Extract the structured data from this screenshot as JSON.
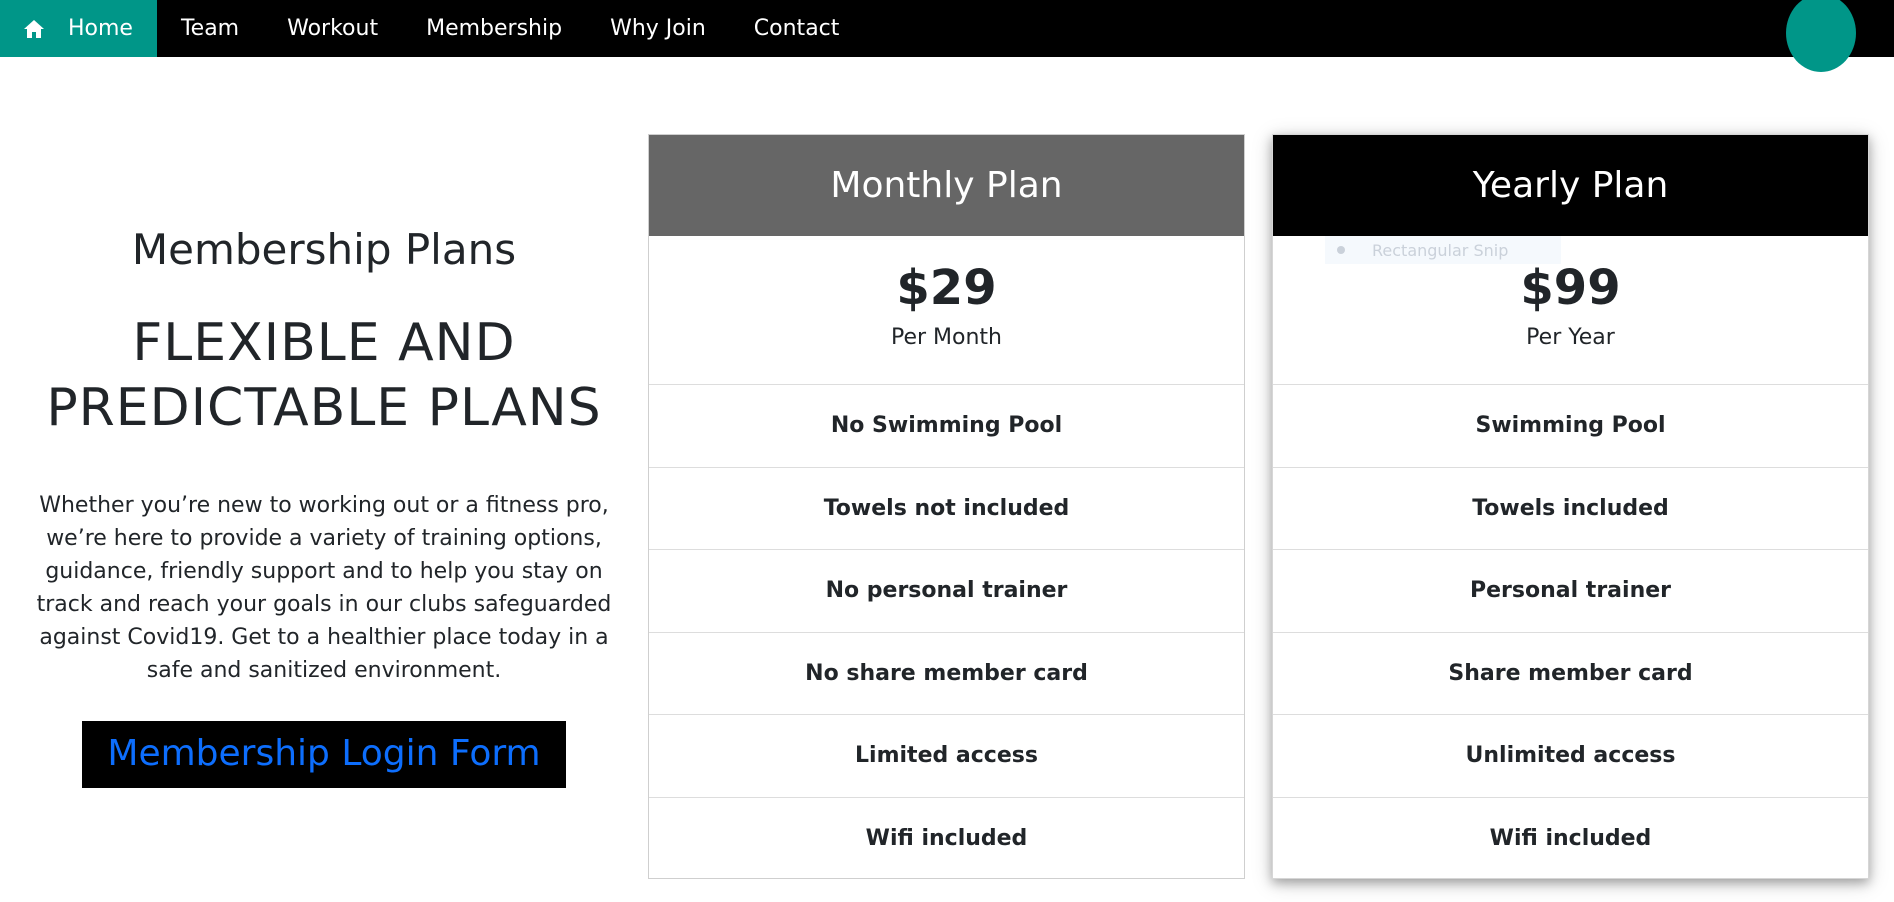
{
  "nav": {
    "items": [
      {
        "label": "Home",
        "icon": "home-icon",
        "active": true
      },
      {
        "label": "Team"
      },
      {
        "label": "Workout"
      },
      {
        "label": "Membership"
      },
      {
        "label": "Why Join"
      },
      {
        "label": "Contact"
      }
    ]
  },
  "colors": {
    "accent": "#009688",
    "nav_bg": "#000000",
    "monthly_header": "#666666",
    "yearly_header": "#000000",
    "link_blue": "#0d6efd"
  },
  "intro": {
    "title": "Membership Plans",
    "headline": "FLEXIBLE AND PREDICTABLE PLANS",
    "description": "Whether you’re new to working out or a fitness pro, we’re here to provide a variety of training options, guidance, friendly support and to help you stay on track and reach your goals in our clubs safeguarded against Covid19. Get to a healthier place today in a safe and sanitized environment.",
    "login_button": "Membership Login Form"
  },
  "plans": {
    "monthly": {
      "name": "Monthly Plan",
      "price": "$29",
      "period": "Per Month",
      "features": [
        "No Swimming Pool",
        "Towels not included",
        "No personal trainer",
        "No share member card",
        "Limited access",
        "Wifi included"
      ]
    },
    "yearly": {
      "name": "Yearly Plan",
      "price": "$99",
      "period": "Per Year",
      "features": [
        "Swimming Pool",
        "Towels included",
        "Personal trainer",
        "Share member card",
        "Unlimited access",
        "Wifi included"
      ]
    }
  },
  "overlay": {
    "snip_label": "Rectangular Snip"
  }
}
